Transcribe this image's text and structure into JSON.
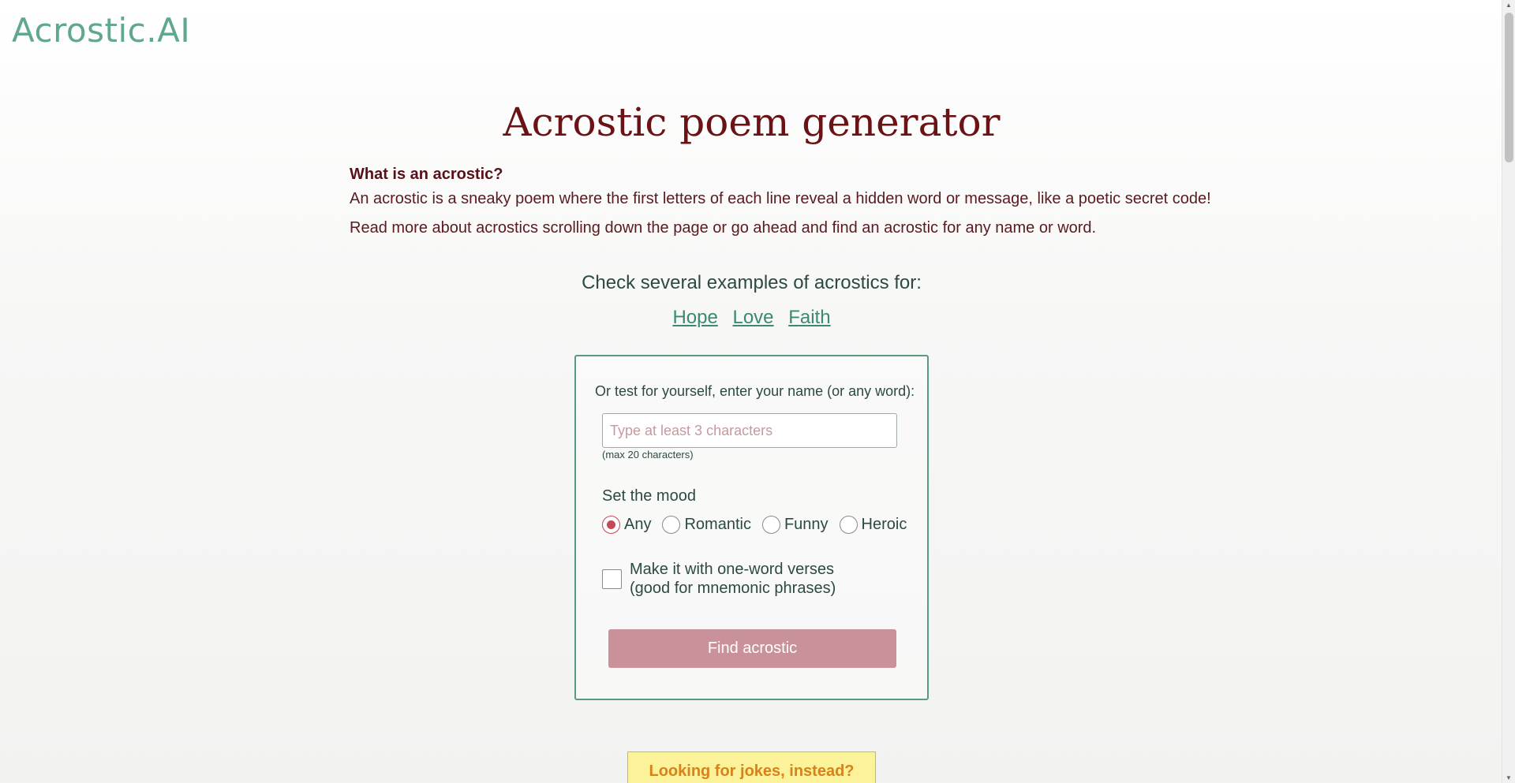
{
  "header": {
    "logo": "Acrostic.AI"
  },
  "main": {
    "title": "Acrostic poem generator",
    "intro_question": "What is an acrostic?",
    "intro_p1": "An acrostic is a sneaky poem where the first letters of each line reveal a hidden word or message, like a poetic secret code!",
    "intro_p2": "Read more about acrostics scrolling down the page or go ahead and find an acrostic for any name or word.",
    "examples_label": "Check several examples of acrostics for:",
    "examples": [
      "Hope",
      "Love",
      "Faith"
    ]
  },
  "form": {
    "prompt": "Or test for yourself, enter your name (or any word):",
    "input_value": "",
    "input_placeholder": "Type at least 3 characters",
    "max_note": "(max 20 characters)",
    "mood_label": "Set the mood",
    "moods": [
      "Any",
      "Romantic",
      "Funny",
      "Heroic"
    ],
    "selected_mood": "Any",
    "oneword_line1": "Make it with one-word verses",
    "oneword_line2": "(good for mnemonic phrases)",
    "oneword_checked": false,
    "submit_label": "Find acrostic"
  },
  "banner": {
    "jokes": "Looking for jokes, instead?"
  },
  "colors": {
    "logo": "#5fa88f",
    "title": "#6b1216",
    "link": "#3a8a70",
    "button": "#c9919a",
    "banner_bg": "#fbf29a",
    "banner_text": "#d9821a"
  }
}
